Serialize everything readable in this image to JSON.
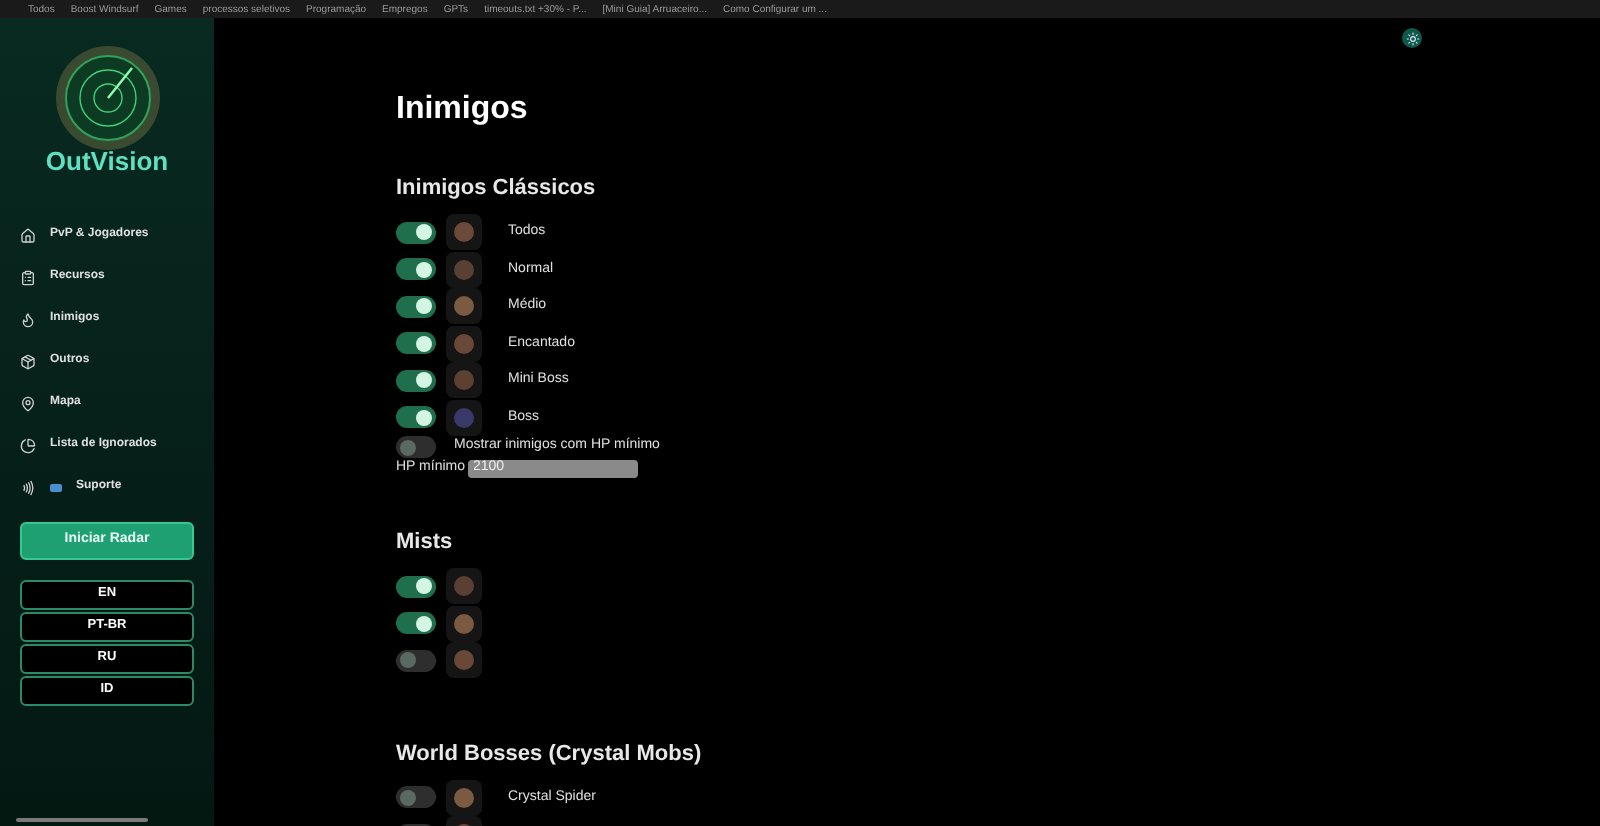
{
  "bookmarks": [
    "Todos",
    "Boost Windsurf",
    "Games",
    "processos seletivos",
    "Programação",
    "Empregos",
    "GPTs",
    "timeouts.txt +30% - P...",
    "[Mini Guia] Arruaceiro...",
    "Como Configurar um ..."
  ],
  "sidebar": {
    "logo_text": "OutVision",
    "nav": [
      {
        "label": "PvP & Jogadores"
      },
      {
        "label": "Recursos"
      },
      {
        "label": "Inimigos"
      },
      {
        "label": "Outros"
      },
      {
        "label": "Mapa"
      },
      {
        "label": "Lista de Ignorados"
      },
      {
        "label": "Suporte"
      }
    ],
    "start_button": "Iniciar Radar",
    "languages": [
      "EN",
      "PT-BR",
      "RU",
      "ID"
    ]
  },
  "page": {
    "title": "Inimigos",
    "sections": [
      {
        "title": "Inimigos Clássicos",
        "items": [
          {
            "label": "Todos",
            "on": true
          },
          {
            "label": "Normal",
            "on": true
          },
          {
            "label": "Médio",
            "on": true
          },
          {
            "label": "Encantado",
            "on": true
          },
          {
            "label": "Mini Boss",
            "on": true
          },
          {
            "label": "Boss",
            "on": true
          }
        ],
        "min_hp_toggle": {
          "label": "Mostrar inimigos com HP mínimo",
          "on": false
        },
        "min_hp_field": {
          "label": "HP mínimo",
          "value": "2100"
        }
      },
      {
        "title": "Mists",
        "items": [
          {
            "on": true
          },
          {
            "on": true
          },
          {
            "on": false
          }
        ]
      },
      {
        "title": "World Bosses (Crystal Mobs)",
        "items": [
          {
            "label": "Crystal Spider",
            "on": false
          },
          {
            "on": false
          }
        ]
      }
    ]
  }
}
